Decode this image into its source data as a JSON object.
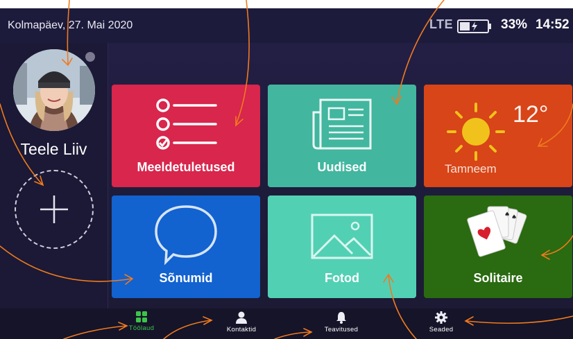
{
  "status_bar": {
    "date": "Kolmapäev, 27. Mai 2020",
    "network": "LTE",
    "battery_percent": "33%",
    "battery_level": 0.33,
    "time": "14:52"
  },
  "sidebar": {
    "user_name": "Teele Liiv",
    "avatar_icon": "user-photo",
    "add_icon": "plus-icon"
  },
  "tiles": [
    {
      "label": "Meeldetuletused",
      "icon": "checklist-icon",
      "color": "#d8264c"
    },
    {
      "label": "Uudised",
      "icon": "newspaper-icon",
      "color": "#42b69f"
    },
    {
      "label": "Tamneem",
      "icon": "sun-icon",
      "color": "#d74518",
      "temperature": "12°"
    },
    {
      "label": "Sõnumid",
      "icon": "speech-bubble-icon",
      "color": "#1262d0"
    },
    {
      "label": "Fotod",
      "icon": "image-icon",
      "color": "#52d0b4"
    },
    {
      "label": "Solitaire",
      "icon": "playing-cards-icon",
      "color": "#2a6a10"
    }
  ],
  "bottom_nav": {
    "items": [
      {
        "label": "Töölaud",
        "icon": "grid-icon",
        "active": true
      },
      {
        "label": "Kontaktid",
        "icon": "person-icon",
        "active": false
      },
      {
        "label": "Teavitused",
        "icon": "bell-icon",
        "active": false
      },
      {
        "label": "Seaded",
        "icon": "gear-icon",
        "active": false
      }
    ]
  },
  "colors": {
    "accent_active": "#3cc44a",
    "annotation_arrow": "#f07a1e",
    "background": "#1e1c3a"
  }
}
